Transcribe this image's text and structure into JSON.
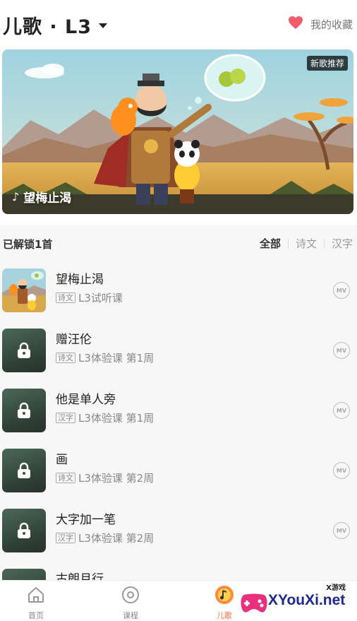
{
  "header": {
    "title": "儿歌 · L3",
    "favorites_label": "我的收藏"
  },
  "banner": {
    "badge": "新歌推荐",
    "song_name": "望梅止渴",
    "note_icon": "♪"
  },
  "list": {
    "unlock_count": "已解锁1首",
    "filters": [
      "全部",
      "诗文",
      "汉字"
    ],
    "active_filter": "全部",
    "songs": [
      {
        "title": "望梅止渴",
        "tag": "诗文",
        "meta": "L3试听课",
        "locked": false,
        "mv": "MV"
      },
      {
        "title": "赠汪伦",
        "tag": "诗文",
        "meta": "L3体验课 第1周",
        "locked": true,
        "mv": "MV"
      },
      {
        "title": "他是单人旁",
        "tag": "汉字",
        "meta": "L3体验课 第1周",
        "locked": true,
        "mv": "MV"
      },
      {
        "title": "画",
        "tag": "诗文",
        "meta": "L3体验课 第2周",
        "locked": true,
        "mv": "MV"
      },
      {
        "title": "大字加一笔",
        "tag": "汉字",
        "meta": "L3体验课 第2周",
        "locked": true,
        "mv": "MV"
      },
      {
        "title": "古朗月行",
        "tag": "",
        "meta": "",
        "locked": true,
        "mv": ""
      }
    ]
  },
  "tabbar": {
    "tabs": [
      {
        "label": "首页",
        "icon": "home-icon"
      },
      {
        "label": "课程",
        "icon": "course-icon"
      },
      {
        "label": "儿歌",
        "icon": "music-icon"
      }
    ],
    "active_tab": "儿歌"
  },
  "watermark": {
    "text": "XYouXi.net",
    "small": "X游戏"
  },
  "colors": {
    "accent": "#ff6a3d",
    "heart": "#f25c6a",
    "watermark_blue": "#1d2a8c",
    "watermark_pink": "#e8307d"
  }
}
